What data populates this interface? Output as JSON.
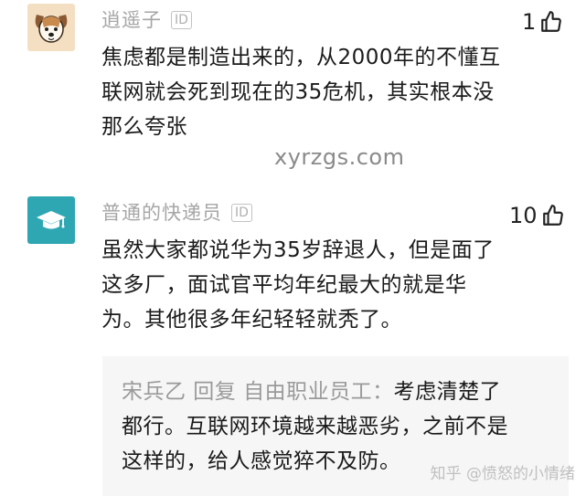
{
  "comments": [
    {
      "username": "逍遥子",
      "badge": "ID",
      "likes": "1",
      "avatar": "dog-avatar",
      "lines": [
        "焦虑都是制造出来的，从2000年的不懂互",
        "联网就会死到现在的35危机，其实根本没",
        "那么夸张"
      ]
    },
    {
      "username": "普通的快递员",
      "badge": "ID",
      "likes": "10",
      "avatar": "graduation-cap-avatar",
      "lines": [
        "虽然大家都说华为35岁辞退人，但是面了",
        "这多厂，面试官平均年纪最大的就是华",
        "为。其他很多年纪轻轻就秃了。"
      ]
    }
  ],
  "reply": {
    "author_line": "宋兵乙 回复 自由职业员工：",
    "first_line_text": "考虑清楚了",
    "lines": [
      "都行。互联网环境越来越恶劣，之前不是",
      "这样的，给人感觉猝不及防。"
    ]
  },
  "watermarks": {
    "center": "xyrzgs.com",
    "corner": "知乎 @愤怒的小情绪"
  },
  "colors": {
    "grad_avatar_bg": "#2fa7b3",
    "dog_avatar_bg": "#f4dfc3",
    "username": "#a6a6a6",
    "reply_bg": "#f6f6f6"
  }
}
